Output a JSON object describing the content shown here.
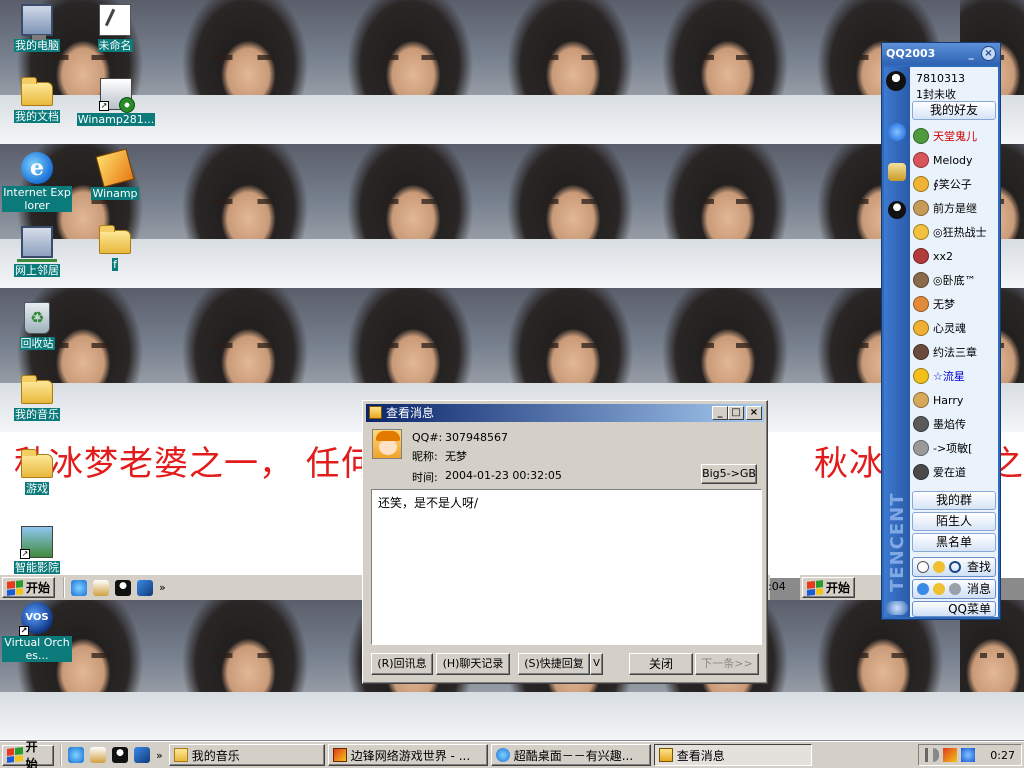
{
  "desktop": {
    "icons": [
      {
        "label": "我的电脑",
        "icon": "my-computer-icon"
      },
      {
        "label": "未命名",
        "icon": "document-icon"
      },
      {
        "label": "我的文档",
        "icon": "folder-icon"
      },
      {
        "label": "Winamp281...",
        "icon": "setup-icon"
      },
      {
        "label": "Internet Explorer",
        "icon": "ie-icon"
      },
      {
        "label": "Winamp",
        "icon": "winamp-icon"
      },
      {
        "label": "网上邻居",
        "icon": "network-icon"
      },
      {
        "label": "f",
        "icon": "folder-icon"
      },
      {
        "label": "回收站",
        "icon": "recycle-bin-icon"
      },
      {
        "label": "我的音乐",
        "icon": "folder-icon"
      },
      {
        "label": "游戏",
        "icon": "folder-icon"
      },
      {
        "label": "智能影院",
        "icon": "movie-icon"
      },
      {
        "label": "Virtual Orches...",
        "icon": "virtual-orchestra-icon"
      }
    ],
    "banner_left": "秋冰梦老婆之一，  任何",
    "banner_right": "秋冰梦老婆之一"
  },
  "inner_taskbars": [
    {
      "start": "开始",
      "clock": ":04"
    },
    {
      "start": "开始"
    }
  ],
  "message_window": {
    "title": "查看消息",
    "qq_label": "QQ#:",
    "qq_number": "307948567",
    "nick_label": "昵称:",
    "nick": "无梦",
    "time_label": "时间:",
    "time": "2004-01-23 00:32:05",
    "convert_button": "Big5->GB",
    "message": "还笑，是不是人呀/",
    "buttons": {
      "reply": "(R)回讯息",
      "history": "(H)聊天记录",
      "quick_reply": "(S)快捷回复",
      "quick_reply_arrow": "V",
      "close": "关闭",
      "next": "下一条>>"
    }
  },
  "qq_panel": {
    "title": "QQ2003",
    "user_number": "7810313",
    "unread": "1封未收",
    "sections": {
      "friends": "我的好友",
      "groups": "我的群",
      "strangers": "陌生人",
      "blacklist": "黑名单"
    },
    "friends": [
      {
        "name": "天堂鬼儿",
        "color": "#cc0000",
        "face": "#4e9a3c"
      },
      {
        "name": "Melody",
        "color": "#000000",
        "face": "#d8545a"
      },
      {
        "name": "∮笑公子",
        "color": "#000000",
        "face": "#f0b432"
      },
      {
        "name": "前方是继",
        "color": "#000000",
        "face": "#c89a5a"
      },
      {
        "name": "◎狂热战士",
        "color": "#000000",
        "face": "#f2c23c"
      },
      {
        "name": "xx2",
        "color": "#000000",
        "face": "#b33a3a"
      },
      {
        "name": "◎卧底™",
        "color": "#000000",
        "face": "#8a6a4a"
      },
      {
        "name": "无梦",
        "color": "#000000",
        "face": "#e08a3a"
      },
      {
        "name": "心灵魂",
        "color": "#000000",
        "face": "#f0b030"
      },
      {
        "name": "约法三章",
        "color": "#000000",
        "face": "#6a4a3a"
      },
      {
        "name": "☆流星",
        "color": "#0000cc",
        "face": "#f2c018"
      },
      {
        "name": "Harry",
        "color": "#000000",
        "face": "#d8a85a"
      },
      {
        "name": "墨焰传",
        "color": "#000000",
        "face": "#5a5a5a"
      },
      {
        "name": "->项敏[",
        "color": "#000000",
        "face": "#9a9a9a"
      },
      {
        "name": "爱在道",
        "color": "#000000",
        "face": "#4a4a4a"
      }
    ],
    "bottom_buttons": {
      "search": "查找",
      "message": "消息",
      "menu": "QQ菜单"
    }
  },
  "taskbar": {
    "start": "开始",
    "tasks": [
      {
        "label": "我的音乐",
        "icon": "folder-icon"
      },
      {
        "label": "边锋网络游戏世界 - ...",
        "icon": "game-icon"
      },
      {
        "label": "超酷桌面－－有兴趣...",
        "icon": "ie-icon"
      },
      {
        "label": "查看消息",
        "icon": "message-icon",
        "active": true
      }
    ],
    "clock": "0:27"
  }
}
